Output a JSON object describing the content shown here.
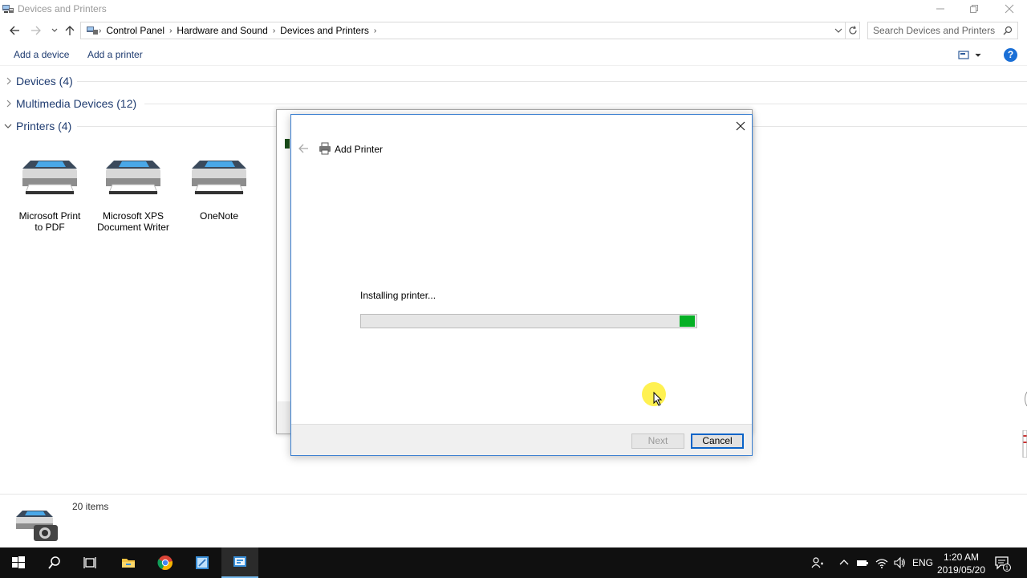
{
  "window": {
    "title": "Devices and Printers",
    "app_icon": "devices-and-printers-icon"
  },
  "address": {
    "crumbs": [
      "Control Panel",
      "Hardware and Sound",
      "Devices and Printers"
    ],
    "search_placeholder": "Search Devices and Printers"
  },
  "commands": {
    "add_device": "Add a device",
    "add_printer": "Add a printer",
    "help": "?"
  },
  "groups": {
    "devices": "Devices (4)",
    "multimedia": "Multimedia Devices (12)",
    "printers": "Printers (4)"
  },
  "printers": [
    {
      "line1": "Microsoft Print",
      "line2": "to PDF"
    },
    {
      "line1": "Microsoft XPS",
      "line2": "Document Writer"
    },
    {
      "line1": "OneNote",
      "line2": ""
    }
  ],
  "status": {
    "item_count": "20 items"
  },
  "dialog": {
    "title": "Add Printer",
    "message": "Installing printer...",
    "progress": 0.95,
    "next_label": "Next",
    "cancel_label": "Cancel",
    "progress_color": "#06b025"
  },
  "taskbar": {
    "language": "ENG",
    "time": "1:20 AM",
    "date": "2019/05/20",
    "notification_count": "1"
  },
  "colors": {
    "link_blue": "#1e3b70",
    "accent": "#0a64c8",
    "taskbar": "#101010"
  }
}
